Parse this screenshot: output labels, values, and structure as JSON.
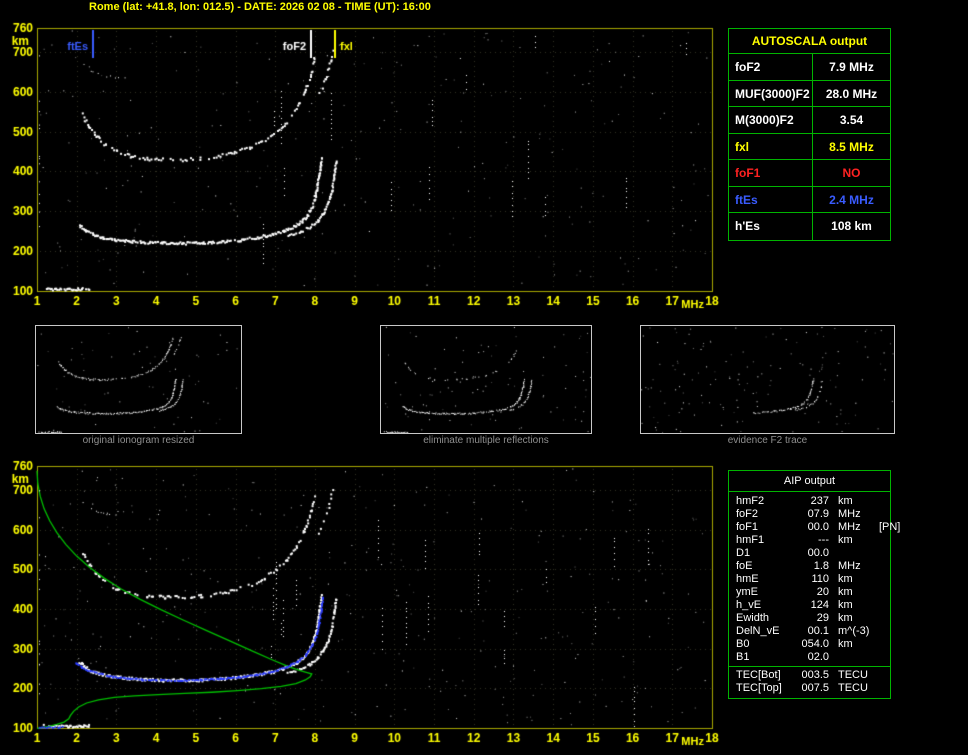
{
  "header": {
    "title": "Rome (lat: +41.8, lon: 012.5) - DATE: 2026 02 08 - TIME (UT): 16:00"
  },
  "autoscala": {
    "title": "AUTOSCALA output",
    "rows": [
      {
        "label": "foF2",
        "value": "7.9 MHz",
        "color": "#ffffff"
      },
      {
        "label": "MUF(3000)F2",
        "value": "28.0 MHz",
        "color": "#ffffff"
      },
      {
        "label": "M(3000)F2",
        "value": "3.54",
        "color": "#ffffff"
      },
      {
        "label": "fxl",
        "value": "8.5 MHz",
        "color": "#ffff00"
      },
      {
        "label": "foF1",
        "value": "NO",
        "color": "#ff2222"
      },
      {
        "label": "ftEs",
        "value": "2.4 MHz",
        "color": "#3a5cff"
      },
      {
        "label": "h'Es",
        "value": "108 km",
        "color": "#ffffff"
      }
    ]
  },
  "aip": {
    "title": "AIP output",
    "rows": [
      {
        "name": "hmF2",
        "value": "237",
        "unit": "km"
      },
      {
        "name": "foF2",
        "value": "07.9",
        "unit": "MHz"
      },
      {
        "name": "foF1",
        "value": "00.0",
        "unit": "MHz      [PN]"
      },
      {
        "name": "hmF1",
        "value": "---",
        "unit": "km"
      },
      {
        "name": "D1",
        "value": "00.0",
        "unit": ""
      },
      {
        "name": "foE",
        "value": "1.8",
        "unit": "MHz"
      },
      {
        "name": "hmE",
        "value": "110",
        "unit": "km"
      },
      {
        "name": "ymE",
        "value": "20",
        "unit": "km"
      },
      {
        "name": "h_vE",
        "value": "124",
        "unit": "km"
      },
      {
        "name": "Ewidth",
        "value": "29",
        "unit": "km"
      },
      {
        "name": "DelN_vE",
        "value": "00.1",
        "unit": "m^(-3)"
      },
      {
        "name": "B0",
        "value": "054.0",
        "unit": "km"
      },
      {
        "name": "B1",
        "value": "02.0",
        "unit": ""
      },
      {
        "name": "TEC[Bot]",
        "value": "003.5",
        "unit": "TECU"
      },
      {
        "name": "TEC[Top]",
        "value": "007.5",
        "unit": "TECU"
      }
    ]
  },
  "thumbnails": [
    {
      "caption": "original ionogram resized",
      "xlim": [
        1,
        11.5
      ],
      "noise": 70,
      "series": [
        {
          "ref": "Es-trace"
        },
        {
          "ref": "F-trace-ordinary"
        },
        {
          "ref": "F-trace-extraordinary"
        },
        {
          "ref": "F-second-reflection"
        },
        {
          "ref": "F-second-reflection-x",
          "gap": 0.55
        }
      ]
    },
    {
      "caption": "eliminate multiple reflections",
      "xlim": [
        1,
        11.5
      ],
      "noise": 90,
      "series": [
        {
          "ref": "Es-trace"
        },
        {
          "ref": "F-trace-ordinary"
        },
        {
          "ref": "F-trace-extraordinary"
        },
        {
          "ref": "F-second-reflection",
          "gap": 0.78
        }
      ]
    },
    {
      "caption": "evidence F2 trace",
      "xlim": [
        1,
        11.5
      ],
      "noise": 150,
      "series": [
        {
          "ref": "F-trace-ordinary",
          "fmin": 5.2,
          "gap": 0.3
        },
        {
          "ref": "F-trace-extraordinary",
          "gap": 0.5
        }
      ]
    }
  ],
  "chart_data": [
    {
      "id": "ionogram-top",
      "type": "scatter",
      "title": "vertical incidence ionogram",
      "xlabel": "MHz",
      "ylabel": "km",
      "xlim": [
        1,
        18
      ],
      "ylim": [
        100,
        760
      ],
      "x_ticks": [
        1,
        2,
        3,
        4,
        5,
        6,
        7,
        8,
        9,
        10,
        11,
        12,
        13,
        14,
        15,
        16,
        17,
        18
      ],
      "y_ticks": [
        760,
        700,
        600,
        500,
        400,
        300,
        200,
        100
      ],
      "grid": true,
      "markers": [
        {
          "label": "ftEs",
          "freq": 2.4,
          "color": "#3a5cff",
          "side": "left"
        },
        {
          "label": "foF2",
          "freq": 7.9,
          "color": "#ffffff",
          "side": "left"
        },
        {
          "label": "fxl",
          "freq": 8.5,
          "color": "#ffff00",
          "side": "right"
        }
      ],
      "series": [
        {
          "name": "Es-trace",
          "color": "#ffffff",
          "style": "scatter",
          "size": 2,
          "step": 1.4,
          "gap": 0.08,
          "jitter": 2.2,
          "points": [
            [
              1.15,
              108
            ],
            [
              1.45,
              106
            ],
            [
              1.8,
              106
            ],
            [
              2.1,
              107
            ],
            [
              2.3,
              108
            ]
          ]
        },
        {
          "name": "F-trace-ordinary",
          "color": "#ffffff",
          "style": "scatter",
          "size": 2,
          "step": 1.4,
          "gap": 0.06,
          "jitter": 2.6,
          "points": [
            [
              2.05,
              268
            ],
            [
              2.2,
              254
            ],
            [
              2.4,
              243
            ],
            [
              2.65,
              236
            ],
            [
              2.95,
              231
            ],
            [
              3.3,
              227
            ],
            [
              3.7,
              224
            ],
            [
              4.15,
              222
            ],
            [
              4.65,
              222
            ],
            [
              5.15,
              223
            ],
            [
              5.65,
              226
            ],
            [
              6.1,
              230
            ],
            [
              6.5,
              236
            ],
            [
              6.9,
              243
            ],
            [
              7.2,
              252
            ],
            [
              7.45,
              263
            ],
            [
              7.65,
              276
            ],
            [
              7.8,
              293
            ],
            [
              7.92,
              316
            ],
            [
              8.0,
              344
            ],
            [
              8.06,
              375
            ],
            [
              8.11,
              408
            ],
            [
              8.15,
              435
            ]
          ]
        },
        {
          "name": "F-trace-extraordinary",
          "color": "#ffffff",
          "style": "scatter",
          "size": 2,
          "step": 1.8,
          "gap": 0.18,
          "jitter": 2.2,
          "points": [
            [
              7.3,
              240
            ],
            [
              7.6,
              250
            ],
            [
              7.85,
              262
            ],
            [
              8.05,
              278
            ],
            [
              8.2,
              298
            ],
            [
              8.32,
              324
            ],
            [
              8.41,
              356
            ],
            [
              8.47,
              392
            ],
            [
              8.51,
              428
            ]
          ]
        },
        {
          "name": "F-second-reflection",
          "color": "#ffffff",
          "style": "scatter",
          "size": 2,
          "step": 2.2,
          "gap": 0.3,
          "jitter": 3.2,
          "points": [
            [
              2.12,
              545
            ],
            [
              2.28,
              515
            ],
            [
              2.48,
              490
            ],
            [
              2.72,
              468
            ],
            [
              3.0,
              452
            ],
            [
              3.35,
              441
            ],
            [
              3.75,
              434
            ],
            [
              4.2,
              431
            ],
            [
              4.65,
              431
            ],
            [
              5.1,
              434
            ],
            [
              5.55,
              440
            ],
            [
              5.95,
              449
            ],
            [
              6.35,
              462
            ],
            [
              6.7,
              479
            ],
            [
              7.0,
              500
            ],
            [
              7.28,
              527
            ],
            [
              7.52,
              560
            ],
            [
              7.72,
              600
            ],
            [
              7.88,
              645
            ],
            [
              7.98,
              690
            ]
          ]
        },
        {
          "name": "F-second-reflection-x",
          "color": "#ffffff",
          "style": "scatter",
          "size": 2,
          "step": 2.6,
          "gap": 0.5,
          "jitter": 3,
          "points": [
            [
              8.05,
              585
            ],
            [
              8.2,
              620
            ],
            [
              8.33,
              660
            ],
            [
              8.44,
              705
            ]
          ]
        },
        {
          "name": "F-third-reflection",
          "color": "#ffffff",
          "style": "scatter",
          "size": 1,
          "step": 3,
          "gap": 0.55,
          "jitter": 2,
          "points": [
            [
              2.15,
              668
            ],
            [
              2.4,
              650
            ],
            [
              2.75,
              640
            ],
            [
              3.2,
              636
            ]
          ]
        }
      ],
      "noise": {
        "dots": 280,
        "streaks": 15
      }
    },
    {
      "id": "ionogram-bottom",
      "type": "scatter",
      "title": "ionogram with restored trace and electron density profile",
      "xlabel": "MHz",
      "ylabel": "km",
      "xlim": [
        1,
        18
      ],
      "ylim": [
        100,
        760
      ],
      "x_ticks": [
        1,
        2,
        3,
        4,
        5,
        6,
        7,
        8,
        9,
        10,
        11,
        12,
        13,
        14,
        15,
        16,
        17,
        18
      ],
      "y_ticks": [
        760,
        700,
        600,
        500,
        400,
        300,
        200,
        100
      ],
      "grid": true,
      "series_from": "ionogram-top",
      "series": [
        {
          "name": "electron-density-profile",
          "color": "#00c000",
          "style": "line",
          "points": [
            [
              1.0,
              748
            ],
            [
              1.02,
              716
            ],
            [
              1.08,
              684
            ],
            [
              1.18,
              652
            ],
            [
              1.32,
              622
            ],
            [
              1.5,
              592
            ],
            [
              1.73,
              562
            ],
            [
              2.0,
              533
            ],
            [
              2.32,
              505
            ],
            [
              2.7,
              477
            ],
            [
              3.12,
              450
            ],
            [
              3.6,
              424
            ],
            [
              4.12,
              398
            ],
            [
              4.68,
              372
            ],
            [
              5.26,
              346
            ],
            [
              5.84,
              320
            ],
            [
              6.4,
              295
            ],
            [
              6.92,
              272
            ],
            [
              7.35,
              254
            ],
            [
              7.67,
              243
            ],
            [
              7.85,
              238
            ],
            [
              7.92,
              236
            ],
            [
              7.88,
              229
            ],
            [
              7.76,
              221
            ],
            [
              7.52,
              212
            ],
            [
              7.15,
              205
            ],
            [
              6.65,
              199
            ],
            [
              6.05,
              194
            ],
            [
              5.4,
              190
            ],
            [
              4.72,
              187
            ],
            [
              4.05,
              184
            ],
            [
              3.45,
              181
            ],
            [
              2.95,
              177
            ],
            [
              2.55,
              171
            ],
            [
              2.25,
              163
            ],
            [
              2.05,
              153
            ],
            [
              1.92,
              142
            ],
            [
              1.84,
              131
            ],
            [
              1.8,
              123
            ],
            [
              1.68,
              115
            ],
            [
              1.5,
              109
            ],
            [
              1.3,
              104
            ],
            [
              1.12,
              101
            ],
            [
              1.0,
              99
            ]
          ]
        },
        {
          "name": "restored-F-trace",
          "color": "#2b3cff",
          "style": "scatter",
          "size": 2,
          "step": 2.2,
          "gap": 0.05,
          "jitter": 1.2,
          "points": [
            [
              1.95,
              266
            ],
            [
              2.12,
              254
            ],
            [
              2.32,
              245
            ],
            [
              2.58,
              238
            ],
            [
              2.9,
              231
            ],
            [
              3.25,
              227
            ],
            [
              3.65,
              224
            ],
            [
              4.1,
              222
            ],
            [
              4.6,
              222
            ],
            [
              5.1,
              223
            ],
            [
              5.6,
              226
            ],
            [
              6.05,
              230
            ],
            [
              6.5,
              236
            ],
            [
              6.9,
              244
            ],
            [
              7.25,
              255
            ],
            [
              7.55,
              270
            ],
            [
              7.77,
              288
            ],
            [
              7.92,
              310
            ],
            [
              8.02,
              338
            ],
            [
              8.09,
              368
            ],
            [
              8.14,
              400
            ],
            [
              8.18,
              432
            ]
          ]
        },
        {
          "name": "restored-Es",
          "color": "#2b3cff",
          "style": "scatter",
          "size": 2,
          "step": 2.5,
          "gap": 0.1,
          "jitter": 1.2,
          "points": [
            [
              0.98,
              104
            ],
            [
              1.62,
              104
            ]
          ]
        }
      ],
      "noise": {
        "dots": 340,
        "streaks": 20
      }
    }
  ]
}
